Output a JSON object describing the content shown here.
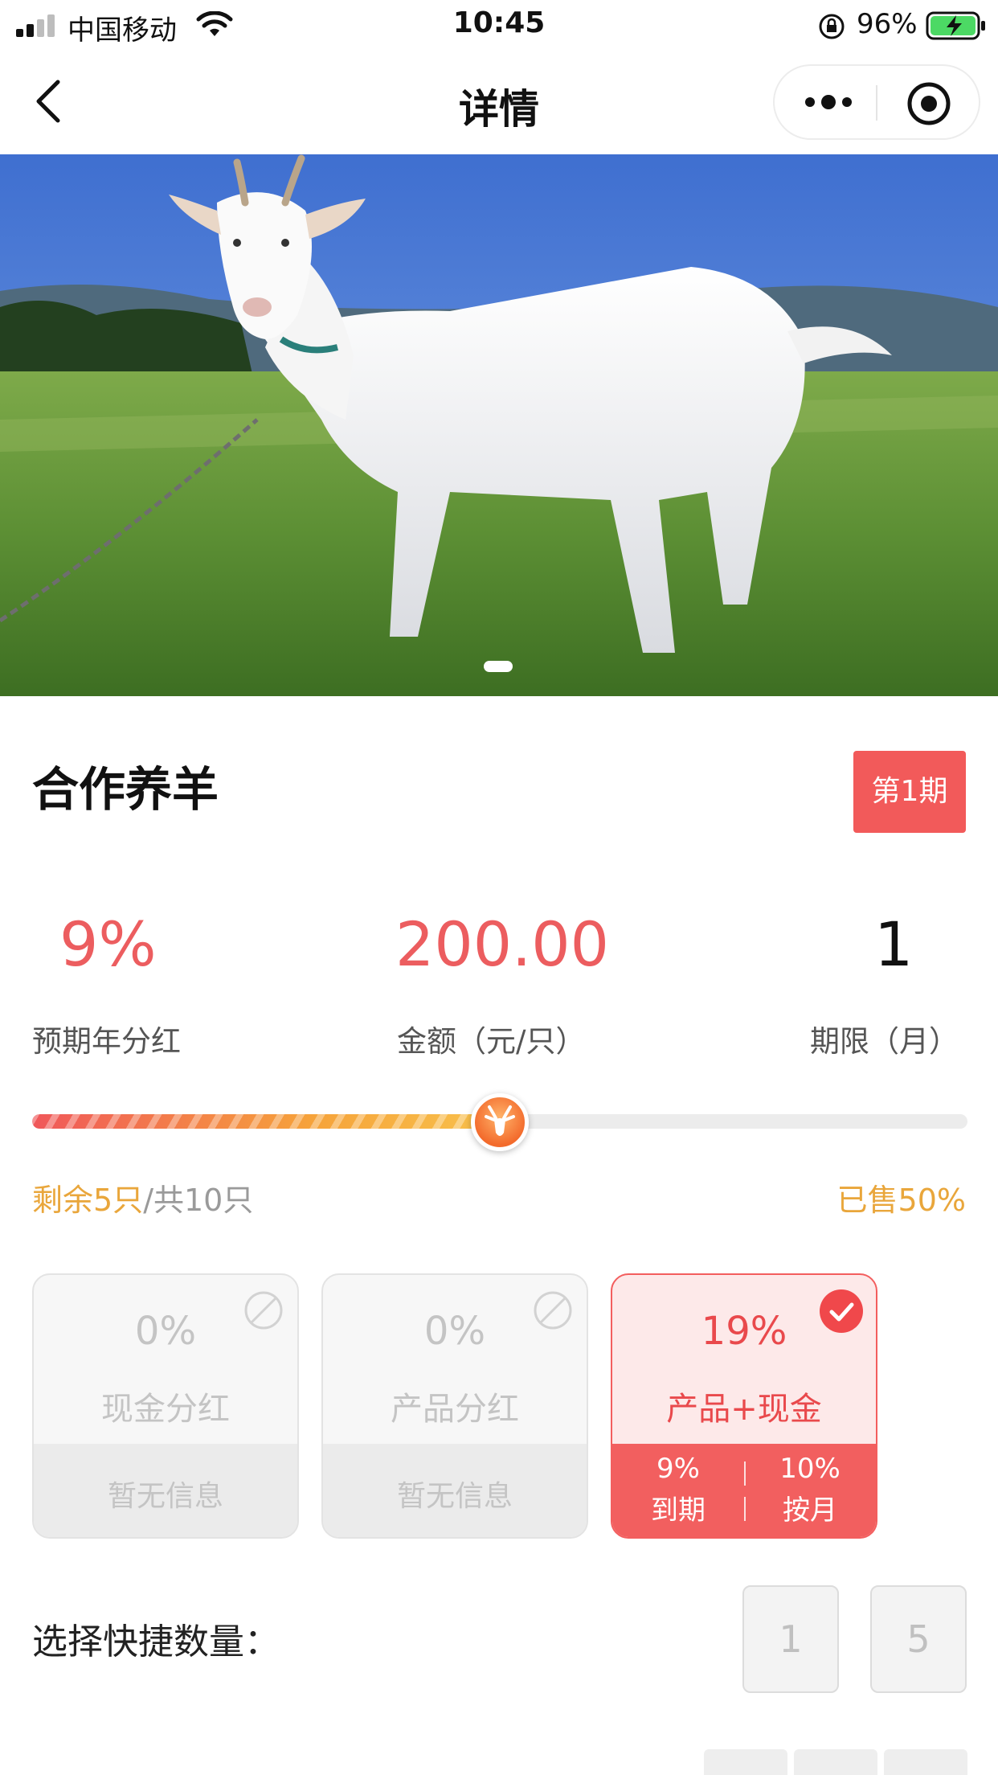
{
  "status_bar": {
    "carrier": "中国移动",
    "time": "10:45",
    "battery_percent": "96%"
  },
  "nav": {
    "title": "详情",
    "back_icon": "chevron-left-icon",
    "more_icon": "more-dots-icon",
    "close_icon": "target-circle-icon"
  },
  "banner": {
    "image_subject": "white goat standing on grass",
    "current_slide": 1,
    "total_slides": 1
  },
  "product": {
    "title": "合作养羊",
    "period_badge": "第1期"
  },
  "stats": [
    {
      "value": "9%",
      "label": "预期年分红"
    },
    {
      "value": "200.00",
      "label": "金额（元/只）"
    },
    {
      "value": "1",
      "label": "期限（月）"
    }
  ],
  "progress": {
    "remaining": "剩余5只",
    "total": "/共10只",
    "sold_text": "已售50%",
    "sold_fraction": 0.5,
    "knob_icon": "goat-icon"
  },
  "options": [
    {
      "pct": "0%",
      "name": "现金分红",
      "info": "暂无信息",
      "selected": false
    },
    {
      "pct": "0%",
      "name": "产品分红",
      "info": "暂无信息",
      "selected": false
    },
    {
      "pct": "19%",
      "name": "产品+现金",
      "selected": true,
      "sub": [
        {
          "pct": "9%",
          "label": "到期"
        },
        {
          "pct": "10%",
          "label": "按月"
        }
      ]
    }
  ],
  "quick_quantity": {
    "label": "选择快捷数量：",
    "values": [
      "1",
      "5"
    ]
  },
  "colors": {
    "accent_red": "#f25a5a",
    "amount_red": "#ec5d5f",
    "stock_amber": "#e9a63b"
  }
}
